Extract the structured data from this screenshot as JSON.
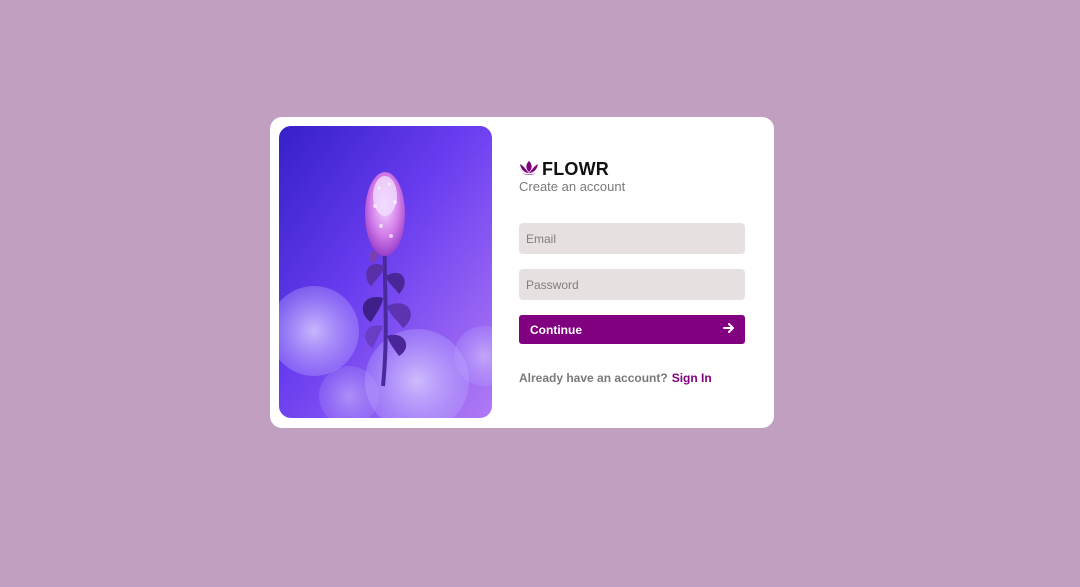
{
  "brand": {
    "name": "FLOWR",
    "logo_icon": "lotus-icon",
    "accent_color": "#800080"
  },
  "form": {
    "subtitle": "Create an account",
    "email_placeholder": "Email",
    "password_placeholder": "Password",
    "continue_label": "Continue",
    "continue_icon": "arrow-right-icon",
    "signin_prompt": "Already have an account?",
    "signin_link": "Sign In"
  },
  "hero": {
    "image": "purple-flower-photo"
  },
  "colors": {
    "background": "#c09fc0",
    "card": "#ffffff",
    "field": "#e6e0e0",
    "button": "#800080"
  }
}
